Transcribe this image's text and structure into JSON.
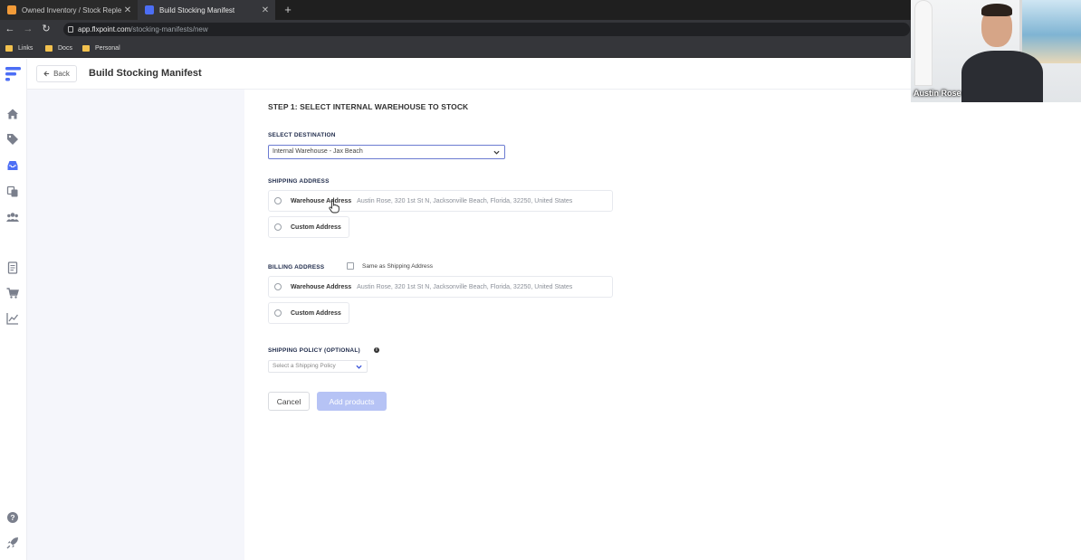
{
  "browser": {
    "tabs": [
      {
        "label": "Owned Inventory / Stock Replen",
        "favicon_color": "#f29b38"
      },
      {
        "label": "Build Stocking Manifest",
        "favicon_color": "#4c6ef5"
      }
    ],
    "new_tab": "+",
    "url_host": "app.flxpoint.com",
    "url_path": "/stocking-manifests/new",
    "bookmarks": [
      "Links",
      "Docs",
      "Personal"
    ]
  },
  "sidebar": {
    "icons": [
      "home-icon",
      "tag-icon",
      "inbox-icon",
      "copy-icon",
      "users-icon",
      "receipt-icon",
      "cart-icon",
      "chart-icon",
      "help-icon",
      "rocket-icon"
    ],
    "active": "inbox-icon"
  },
  "header": {
    "back_label": "Back",
    "title": "Build Stocking Manifest"
  },
  "form": {
    "step_title": "STEP 1: SELECT INTERNAL WAREHOUSE TO STOCK",
    "destination_label": "SELECT DESTINATION",
    "destination_value": "Internal Warehouse - Jax Beach",
    "shipping_label": "SHIPPING ADDRESS",
    "shipping_options": [
      {
        "label": "Warehouse Address",
        "address": "Austin Rose, 320 1st St N, Jacksonville Beach, Florida, 32250, United States"
      },
      {
        "label": "Custom Address",
        "address": ""
      }
    ],
    "billing_label": "BILLING ADDRESS",
    "same_as_shipping": "Same as Shipping Address",
    "billing_options": [
      {
        "label": "Warehouse Address",
        "address": "Austin Rose, 320 1st St N, Jacksonville Beach, Florida, 32250, United States"
      },
      {
        "label": "Custom Address",
        "address": ""
      }
    ],
    "policy_label": "SHIPPING POLICY (OPTIONAL)",
    "policy_placeholder": "Select a Shipping Policy",
    "cancel_label": "Cancel",
    "add_label": "Add products"
  },
  "video": {
    "name": "Austin Rose"
  },
  "colors": {
    "accent": "#4c6ef5",
    "add_button_disabled": "#b6c3f5",
    "sidebar_active": "#4c6ef5",
    "sidebar_icon": "#7a7f8c"
  }
}
